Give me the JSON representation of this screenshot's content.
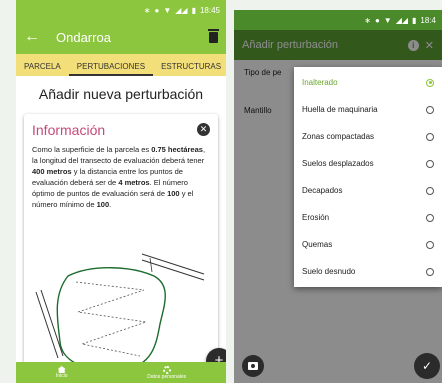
{
  "left_screen": {
    "status_bar": {
      "icons": [
        "bluetooth-icon",
        "minus-circle-icon",
        "wifi-icon",
        "signal-icon",
        "signal-icon",
        "battery-icon"
      ],
      "time": "18:45"
    },
    "app_bar": {
      "back_label": "←",
      "title": "Ondarroa",
      "delete_icon": "trash-icon"
    },
    "tabs": [
      {
        "label": "PARCELA",
        "active": false
      },
      {
        "label": "PERTUBACIONES",
        "active": true
      },
      {
        "label": "ESTRUCTURAS",
        "active": false
      }
    ],
    "page_title": "Añadir nueva perturbación",
    "info_card": {
      "title": "Información",
      "close_icon": "close-circle-icon",
      "text_1": "Como la superficie de la parcela es ",
      "area": "0.75 hectáreas",
      "text_2": ", la longitud del transecto de evaluación deberá tener ",
      "length": "400 metros",
      "text_3": " y la distancia entre los puntos de evaluación deberá ser de ",
      "distance": "4 metros",
      "text_4": ". El número óptimo de puntos de evaluación será de ",
      "optimal_points": "100",
      "text_5": " y el número mínimo de ",
      "min_points": "100",
      "text_6": "."
    },
    "fab_add_label": "+",
    "bottom_nav": [
      {
        "label": "Inicio",
        "icon": "home-icon"
      },
      {
        "label": "Datos personales",
        "icon": "gear-icon"
      }
    ],
    "colors": {
      "primary": "#8cc63f",
      "tabs_bg": "#f3df7a",
      "info_title": "#c54a78"
    }
  },
  "right_screen": {
    "status_bar": {
      "icons": [
        "bluetooth-icon",
        "minus-circle-icon",
        "wifi-icon",
        "signal-icon",
        "signal-icon",
        "battery-icon"
      ],
      "time": "18:4"
    },
    "app_bar": {
      "title": "Añadir perturbación",
      "info_icon": "info-icon",
      "close_icon": "close-icon"
    },
    "rows": [
      {
        "label": "Tipo de pe"
      },
      {
        "label": "Mantillo"
      }
    ],
    "dropdown_options": [
      {
        "label": "Inalterado",
        "selected": true
      },
      {
        "label": "Huella de maquinaria",
        "selected": false
      },
      {
        "label": "Zonas compactadas",
        "selected": false
      },
      {
        "label": "Suelos desplazados",
        "selected": false
      },
      {
        "label": "Decapados",
        "selected": false
      },
      {
        "label": "Erosión",
        "selected": false
      },
      {
        "label": "Quemas",
        "selected": false
      },
      {
        "label": "Suelo desnudo",
        "selected": false
      }
    ],
    "fab_camera_icon": "camera-icon",
    "fab_check_label": "✓",
    "colors": {
      "primary": "#5ba034",
      "status": "#4a8a2a",
      "radio_selected": "#8cc63f"
    }
  }
}
